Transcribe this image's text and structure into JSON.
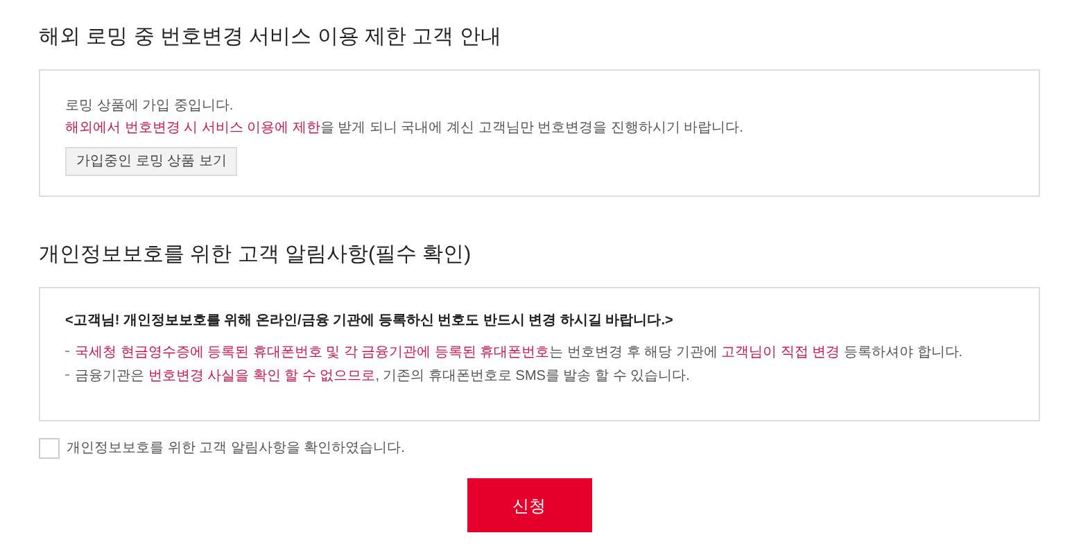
{
  "roaming_section": {
    "title": "해외 로밍 중 번호변경 서비스 이용 제한 고객 안내",
    "lines": [
      [
        {
          "text": "로밍 상품에 가입 중입니다.",
          "highlight": false
        }
      ],
      [
        {
          "text": "해외에서 번호변경 시 서비스 이용에 제한",
          "highlight": true
        },
        {
          "text": "을 받게 되니 국내에 계신 고객님만 번호변경을 진행하시기 바랍니다.",
          "highlight": false
        }
      ]
    ],
    "button": "가입중인 로밍 상품 보기"
  },
  "privacy_section": {
    "title": "개인정보보호를 위한 고객 알림사항(필수 확인)",
    "heading": "<고객님! 개인정보보호를 위해 온라인/금융 기관에 등록하신 번호도 반드시 변경 하시길 바랍니다.>",
    "notes": [
      [
        {
          "text": "국세청 현금영수증에 등록된 휴대폰번호 및 각 금융기관에 등록된 휴대폰번호",
          "highlight": true
        },
        {
          "text": "는 번호변경 후 해당 기관에 ",
          "highlight": false
        },
        {
          "text": "고객님이 직접 변경",
          "highlight": true
        },
        {
          "text": " 등록하셔야 합니다.",
          "highlight": false
        }
      ],
      [
        {
          "text": "금융기관은 ",
          "highlight": false
        },
        {
          "text": "번호변경 사실을 확인 할 수 없으므로",
          "highlight": true
        },
        {
          "text": ", 기존의 휴대폰번호로 SMS를 발송 할 수 있습니다.",
          "highlight": false
        }
      ]
    ]
  },
  "agreement": {
    "label": "개인정보보호를 위한 고객 알림사항을 확인하였습니다.",
    "checked": false
  },
  "submit_button": "신청"
}
